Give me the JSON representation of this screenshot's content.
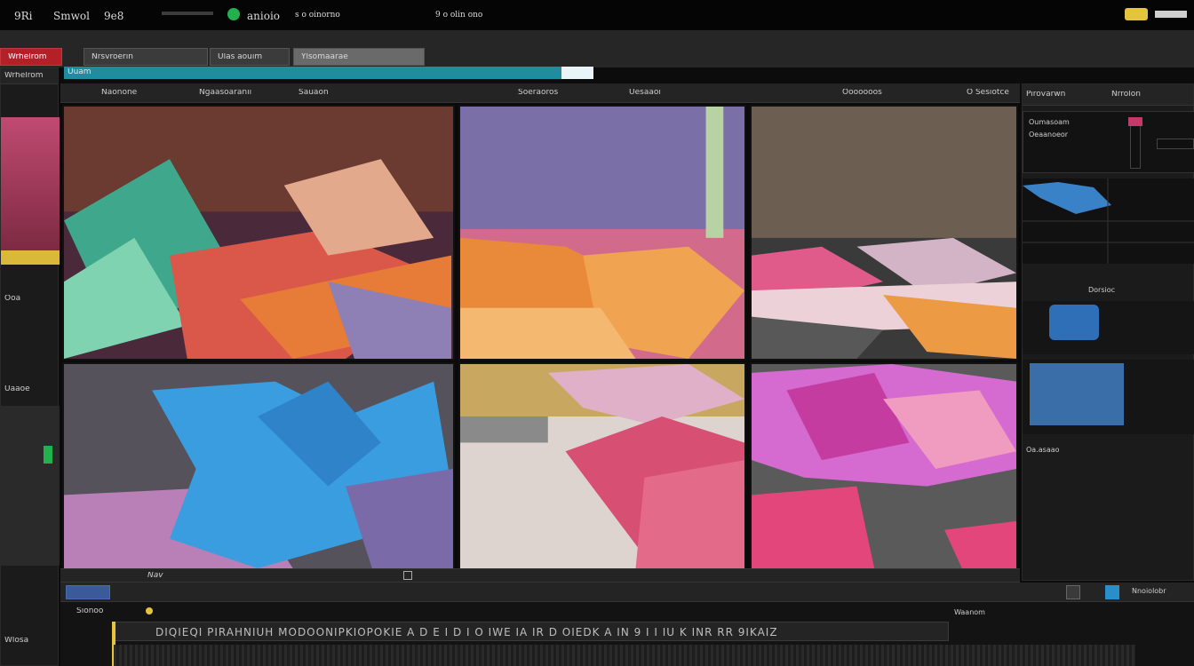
{
  "menubar": {
    "items": [
      "9Ri",
      "Smwol",
      "9e8",
      "anioio",
      "s o oinorno",
      "9 o olin ono"
    ]
  },
  "tabs": [
    {
      "label": "Wrhelrom"
    },
    {
      "label": "Nrsvroerin"
    },
    {
      "label": "Ulas aouim"
    },
    {
      "label": "Ylsomaarae"
    }
  ],
  "editor": {
    "file_title": "Uuam",
    "toolbar_items": [
      "Naonone",
      "Ngaasoaranii",
      "Sauaon",
      "Soeraoros",
      "Uesaaoi",
      "Ooooooos",
      "O Sesiotce"
    ]
  },
  "viewer": {
    "tiles": [
      {
        "name": "paper-cutting-closeup"
      },
      {
        "name": "orange-fold-pile"
      },
      {
        "name": "pink-sheet-stack"
      },
      {
        "name": "blue-origami-star"
      },
      {
        "name": "pink-origami-crease"
      },
      {
        "name": "magenta-origami-folds"
      }
    ],
    "footer_label": "Nav"
  },
  "right_panel": {
    "header_items": [
      "Pirovarwn",
      "Nrrolon"
    ],
    "row_labels": [
      "Oumasoam",
      "Oeaanoeor",
      "Dorsioc",
      "Oa.asaao"
    ]
  },
  "left_panel": {
    "labels": [
      "Wrhelrom",
      "Ooa",
      "Uaaoe",
      "Wlosa"
    ]
  },
  "timeline": {
    "header_label": "Nnoiolobr",
    "track_label": "Sionoo",
    "sub_label": "Waanom",
    "ruler_text": "DIQIEQI PIRAHNIUH MODOONIPKIOPOKIE A D E I D I O IWE IA IR D OIEDK A IN 9 I I IU K INR RR 9IKAIZ"
  },
  "colors": {
    "accent_teal": "#1f8c9f",
    "accent_red": "#b32027",
    "accent_green": "#23b14d",
    "accent_yellow": "#e4c43b"
  }
}
